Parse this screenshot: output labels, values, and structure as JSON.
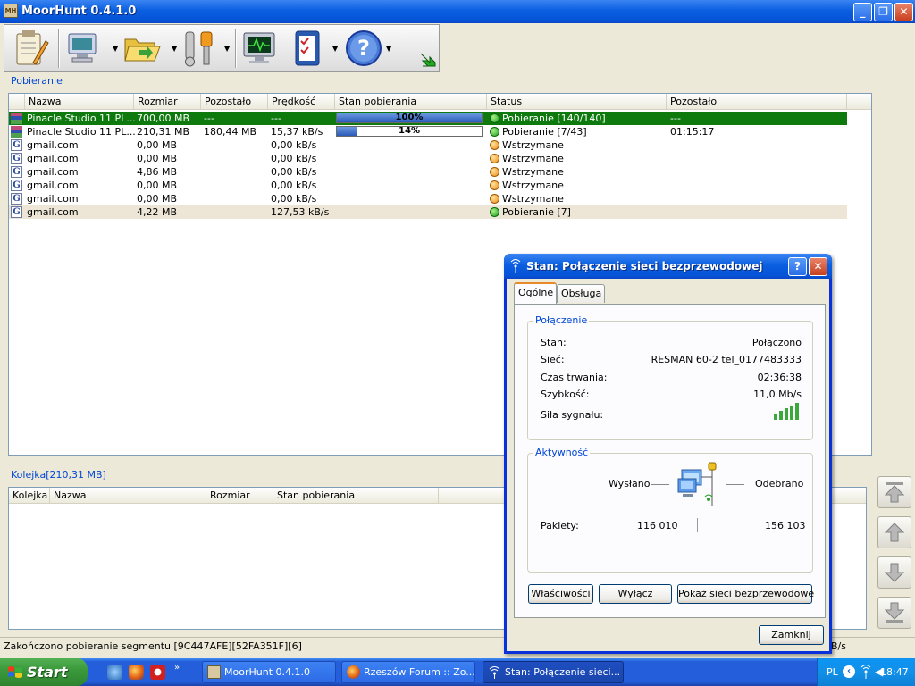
{
  "window": {
    "title": "MoorHunt 0.4.1.0"
  },
  "downloads": {
    "group_label": "Pobieranie",
    "columns": [
      "Nazwa",
      "Rozmiar",
      "Pozostało",
      "Prędkość",
      "Stan pobierania",
      "Status",
      "Pozostało"
    ],
    "rows": [
      {
        "icon": "archive-icon",
        "name": "Pinacle Studio 11 PL...",
        "size": "700,00 MB",
        "remaining": "---",
        "speed": "---",
        "progress_pct": 100,
        "progress_label": "100%",
        "status_color": "green",
        "status": "Pobieranie [140/140]",
        "time_left": "---"
      },
      {
        "icon": "archive-icon",
        "name": "Pinacle Studio 11 PL...",
        "size": "210,31 MB",
        "remaining": "180,44 MB",
        "speed": "15,37 kB/s",
        "progress_pct": 14,
        "progress_label": "14%",
        "status_color": "green",
        "status": "Pobieranie [7/43]",
        "time_left": "01:15:17"
      },
      {
        "icon": "gmail-icon",
        "name": "gmail.com",
        "size": "0,00 MB",
        "remaining": "",
        "speed": "0,00 kB/s",
        "progress_pct": null,
        "progress_label": "",
        "status_color": "orange",
        "status": "Wstrzymane",
        "time_left": ""
      },
      {
        "icon": "gmail-icon",
        "name": "gmail.com",
        "size": "0,00 MB",
        "remaining": "",
        "speed": "0,00 kB/s",
        "progress_pct": null,
        "progress_label": "",
        "status_color": "orange",
        "status": "Wstrzymane",
        "time_left": ""
      },
      {
        "icon": "gmail-icon",
        "name": "gmail.com",
        "size": "4,86 MB",
        "remaining": "",
        "speed": "0,00 kB/s",
        "progress_pct": null,
        "progress_label": "",
        "status_color": "orange",
        "status": "Wstrzymane",
        "time_left": ""
      },
      {
        "icon": "gmail-icon",
        "name": "gmail.com",
        "size": "0,00 MB",
        "remaining": "",
        "speed": "0,00 kB/s",
        "progress_pct": null,
        "progress_label": "",
        "status_color": "orange",
        "status": "Wstrzymane",
        "time_left": ""
      },
      {
        "icon": "gmail-icon",
        "name": "gmail.com",
        "size": "0,00 MB",
        "remaining": "",
        "speed": "0,00 kB/s",
        "progress_pct": null,
        "progress_label": "",
        "status_color": "orange",
        "status": "Wstrzymane",
        "time_left": ""
      },
      {
        "icon": "gmail-icon",
        "name": "gmail.com",
        "size": "4,22 MB",
        "remaining": "",
        "speed": "127,53 kB/s",
        "progress_pct": null,
        "progress_label": "",
        "status_color": "green",
        "status": "Pobieranie [7]",
        "time_left": ""
      }
    ]
  },
  "queue": {
    "group_label": "Kolejka[210,31 MB]",
    "columns": [
      "Kolejka",
      "Nazwa",
      "Rozmiar",
      "Stan pobierania"
    ]
  },
  "statusbar": {
    "text": "Zakończono pobieranie segmentu [9C447AFE][52FA351F][6]",
    "right_fragment": "B/s"
  },
  "taskbar": {
    "start_label": "Start",
    "tasks": [
      "MoorHunt 0.4.1.0",
      "Rzeszów Forum :: Zo...",
      "Stan: Połączenie sieci..."
    ],
    "tray_lang": "PL",
    "clock": "18:47"
  },
  "dialog": {
    "title": "Stan: Połączenie sieci bezprzewodowej",
    "tabs": [
      "Ogólne",
      "Obsługa"
    ],
    "connection_legend": "Połączenie",
    "connection": [
      {
        "label": "Stan:",
        "value": "Połączono"
      },
      {
        "label": "Sieć:",
        "value": "RESMAN 60-2 tel_0177483333"
      },
      {
        "label": "Czas trwania:",
        "value": "02:36:38"
      },
      {
        "label": "Szybkość:",
        "value": "11,0 Mb/s"
      },
      {
        "label": "Siła sygnału:",
        "value": ""
      }
    ],
    "signal_bars": 5,
    "activity_legend": "Aktywność",
    "sent_label": "Wysłano",
    "received_label": "Odebrano",
    "packets_label": "Pakiety:",
    "packets_sent": "116 010",
    "packets_received": "156 103",
    "buttons": [
      "Właściwości",
      "Wyłącz",
      "Pokaż sieci bezprzewodowe"
    ],
    "close_label": "Zamknij"
  }
}
